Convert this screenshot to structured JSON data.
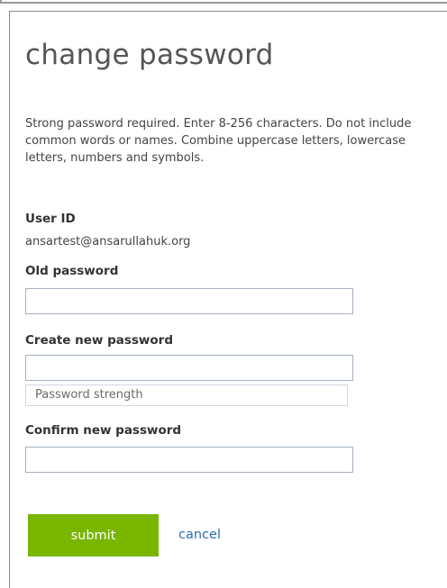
{
  "form": {
    "title": "change password",
    "instructions": "Strong password required. Enter 8-256 characters. Do not include common words or names. Combine uppercase letters, lowercase letters, numbers and symbols.",
    "user_id_label": "User ID",
    "user_id_value": "ansartest@ansarullahuk.org",
    "old_password_label": "Old password",
    "old_password_value": "",
    "new_password_label": "Create new password",
    "new_password_value": "",
    "strength_label": "Password strength",
    "confirm_password_label": "Confirm new password",
    "confirm_password_value": "",
    "submit_label": "submit",
    "cancel_label": "cancel"
  },
  "colors": {
    "accent_green": "#78b600",
    "link_blue": "#2a6fb5",
    "input_border": "#a5b2c2"
  }
}
